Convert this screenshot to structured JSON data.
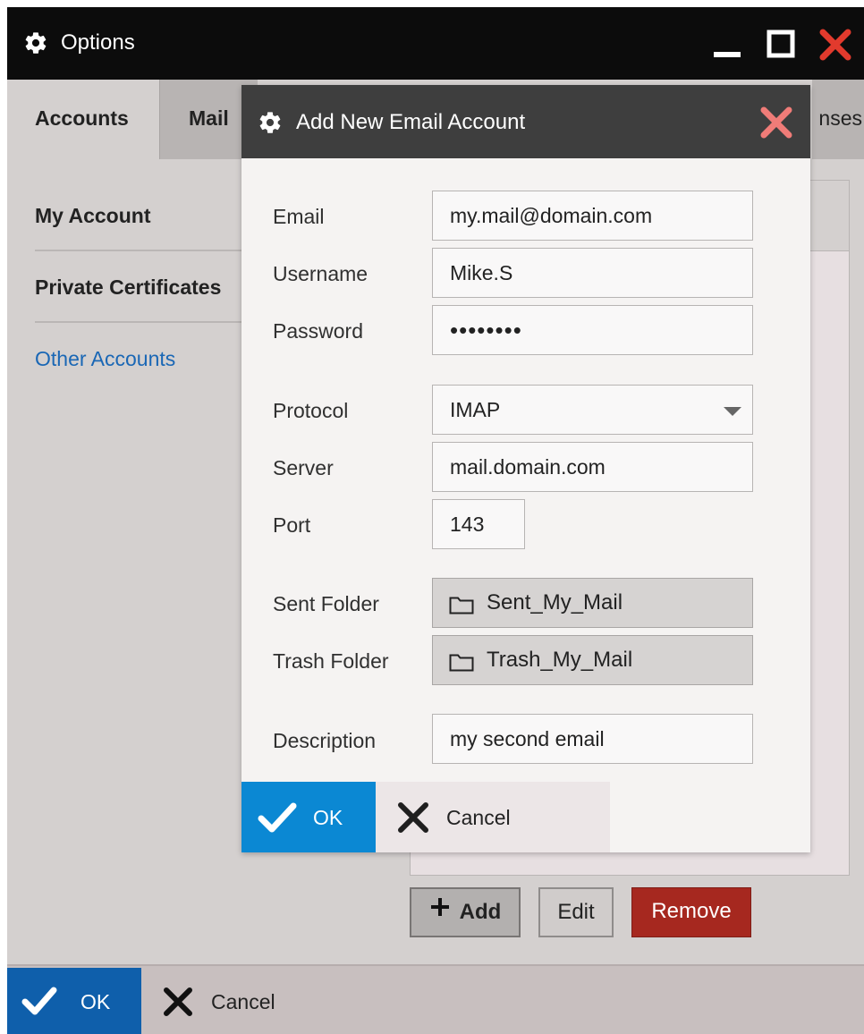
{
  "window": {
    "title": "Options",
    "title_icon": "gear-icon",
    "controls": [
      "minimize-icon",
      "maximize-icon",
      "close-icon"
    ]
  },
  "tabs": [
    {
      "label": "Accounts",
      "active": true
    },
    {
      "label": "Mail",
      "active": false
    },
    {
      "label": "nses",
      "active": false
    }
  ],
  "sidebar": {
    "items": [
      {
        "label": "My Account",
        "selected": false
      },
      {
        "label": "Private Certificates",
        "selected": false
      },
      {
        "label": "Other Accounts",
        "selected": true
      }
    ]
  },
  "panel_buttons": {
    "add": "Add",
    "edit": "Edit",
    "remove": "Remove"
  },
  "footer": {
    "ok": "OK",
    "cancel": "Cancel"
  },
  "dialog": {
    "title": "Add New Email Account",
    "fields": {
      "email": {
        "label": "Email",
        "value": "my.mail@domain.com"
      },
      "username": {
        "label": "Username",
        "value": "Mike.S"
      },
      "password": {
        "label": "Password",
        "value": "••••••••"
      },
      "protocol": {
        "label": "Protocol",
        "value": "IMAP"
      },
      "server": {
        "label": "Server",
        "value": "mail.domain.com"
      },
      "port": {
        "label": "Port",
        "value": "143"
      },
      "sent_folder": {
        "label": "Sent Folder",
        "value": "Sent_My_Mail"
      },
      "trash_folder": {
        "label": "Trash Folder",
        "value": "Trash_My_Mail"
      },
      "description": {
        "label": "Description",
        "value": "my second email"
      }
    },
    "ok": "OK",
    "cancel": "Cancel"
  },
  "colors": {
    "titlebar": "#0c0c0c",
    "close_red": "#e23a2d",
    "dialog_title": "#3e3e3e",
    "dialog_close": "#f07c78",
    "ok_blue": "#0b88d3",
    "footer_ok_blue": "#0f5fab",
    "remove_red": "#a6281f",
    "link_blue": "#1a67b5"
  }
}
